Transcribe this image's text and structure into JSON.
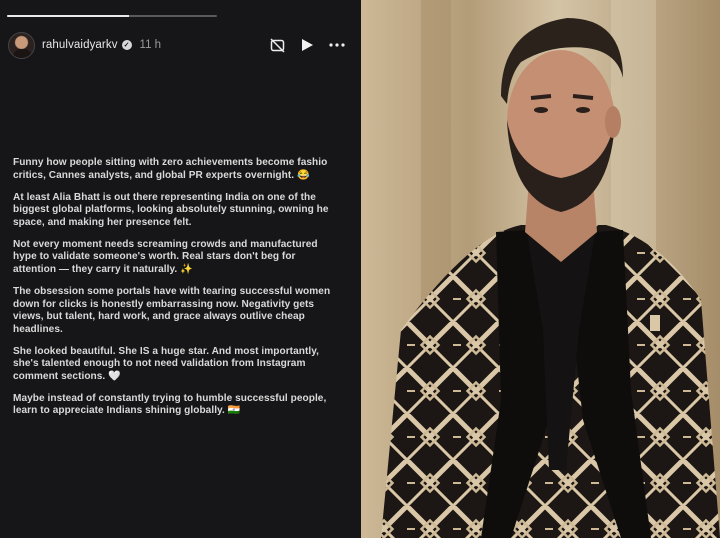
{
  "story": {
    "progress": 0.58,
    "username": "rahulvaidyarkv",
    "timestamp": "11 h",
    "icons": [
      "avatar",
      "verified-badge-icon",
      "mute-icon",
      "play-icon",
      "more-icon"
    ],
    "paragraphs": [
      [
        "Funny how people sitting with zero achievements become fashio",
        "critics, Cannes analysts, and global PR experts overnight. 😂"
      ],
      [
        "At least Alia Bhatt is out there representing India on one of the",
        "biggest global platforms, looking absolutely stunning, owning he",
        "space, and making her presence felt."
      ],
      [
        "Not every moment needs screaming crowds and manufactured",
        "hype to validate someone's worth. Real stars don't beg for",
        "attention — they carry it naturally. ✨"
      ],
      [
        "The obsession some portals have with tearing successful women",
        "down for clicks is honestly embarrassing now. Negativity gets",
        "views, but talent, hard work, and grace always outlive cheap",
        "headlines."
      ],
      [
        "She looked beautiful. She IS a huge star. And most importantly,",
        "she's talented enough to not need validation from Instagram",
        "comment sections. 🤍"
      ],
      [
        "Maybe instead of constantly trying to humble successful people,",
        "learn to appreciate Indians shining globally. 🇮🇳"
      ]
    ]
  },
  "colors": {
    "story_bg": "#161618",
    "text": "#d9d9d9",
    "photo_bg": "#c8b494"
  }
}
